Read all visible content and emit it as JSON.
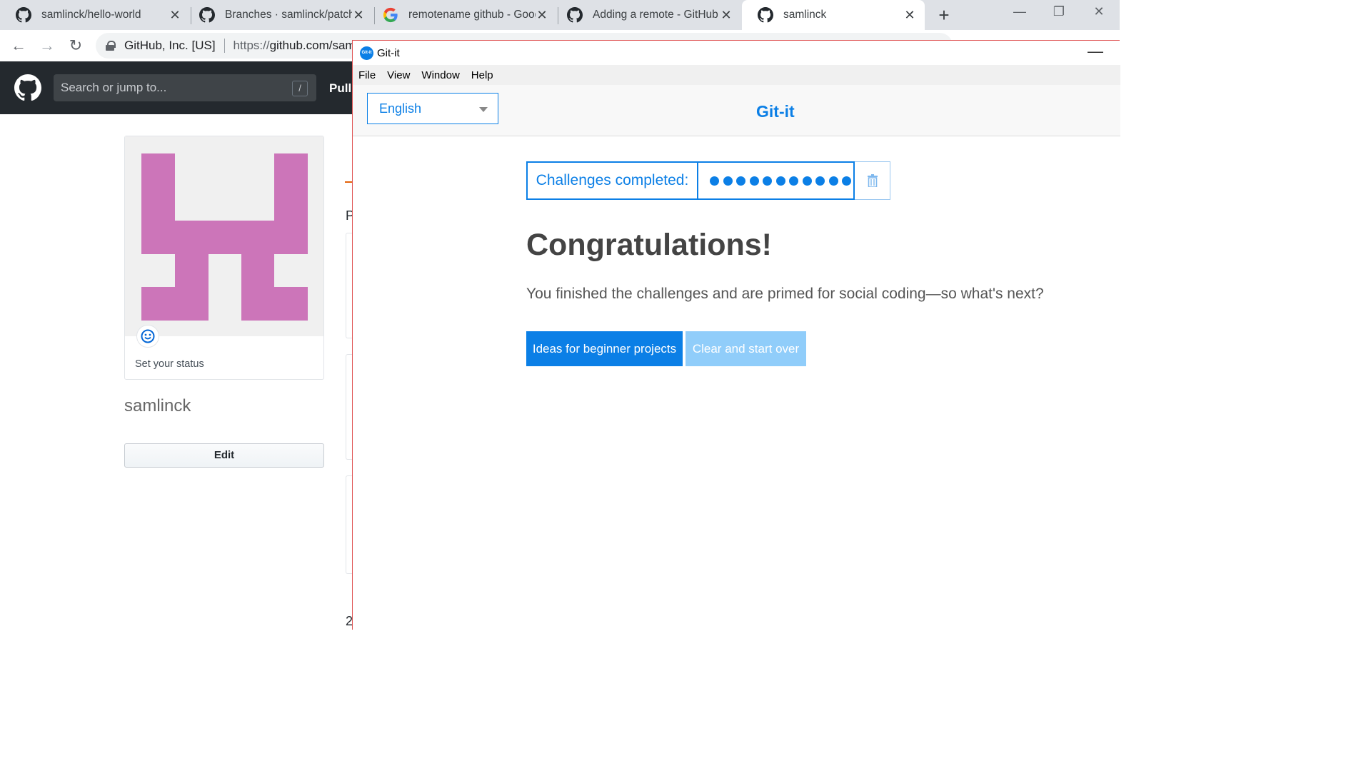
{
  "browser": {
    "tabs": [
      {
        "title": "samlinck/hello-world",
        "icon": "github-icon",
        "active": false
      },
      {
        "title": "Branches · samlinck/patchwork",
        "icon": "github-icon",
        "active": false
      },
      {
        "title": "remotename github - Google Search",
        "icon": "google-icon",
        "active": false
      },
      {
        "title": "Adding a remote - GitHub Help",
        "icon": "github-icon",
        "active": false
      },
      {
        "title": "samlinck",
        "icon": "github-icon",
        "active": true
      }
    ],
    "new_tab": "+",
    "site_identity": "GitHub, Inc. [US]",
    "url_proto": "https://",
    "url_rest": "github.com/samlinck"
  },
  "github": {
    "search_placeholder": "Search or jump to...",
    "search_key": "/",
    "nav_pull": "Pull requests",
    "status_text": "Set your status",
    "username": "samlinck",
    "edit_label": "Edit",
    "peek_p": "P",
    "peek_2": "2"
  },
  "gitit": {
    "window_title": "Git-it",
    "menu": [
      "File",
      "View",
      "Window",
      "Help"
    ],
    "language": "English",
    "brand": "Git-it",
    "progress_label": "Challenges completed:",
    "challenges_completed": 11,
    "heading": "Congratulations!",
    "paragraph": "You finished the challenges and are primed for social coding—so what's next?",
    "btn_primary": "Ideas for beginner projects",
    "btn_secondary": "Clear and start over",
    "accent": "#0b7fe6"
  }
}
